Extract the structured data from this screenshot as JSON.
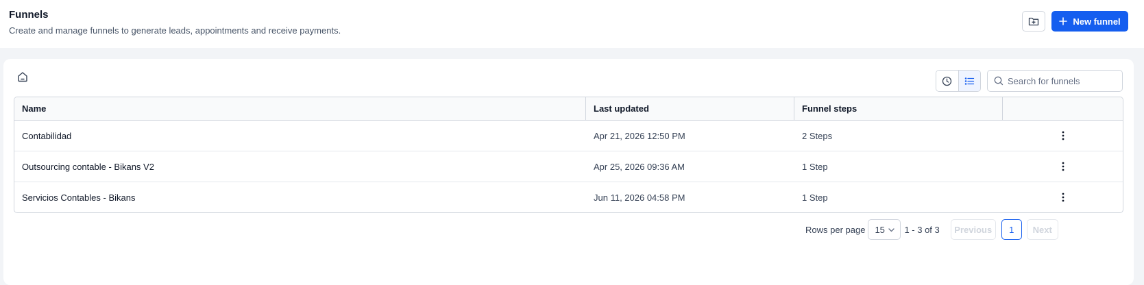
{
  "header": {
    "title": "Funnels",
    "subtitle": "Create and manage funnels to generate leads, appointments and receive payments.",
    "new_funnel_label": "New funnel"
  },
  "toolbar": {
    "search_placeholder": "Search for funnels"
  },
  "table": {
    "columns": [
      "Name",
      "Last updated",
      "Funnel steps",
      ""
    ],
    "rows": [
      {
        "name": "Contabilidad",
        "updated": "Apr 21, 2026 12:50 PM",
        "steps": "2 Steps"
      },
      {
        "name": "Outsourcing contable - Bikans V2",
        "updated": "Apr 25, 2026 09:36 AM",
        "steps": "1 Step"
      },
      {
        "name": "Servicios Contables - Bikans",
        "updated": "Jun 11, 2026 04:58 PM",
        "steps": "1 Step"
      }
    ]
  },
  "pagination": {
    "rows_per_page_label": "Rows per page",
    "rows_per_page": "15",
    "range": "1 - 3 of 3",
    "previous": "Previous",
    "current_page": "1",
    "next": "Next"
  },
  "colors": {
    "accent": "#155eef",
    "background": "#f2f4f7",
    "border": "#d0d5dd"
  },
  "icons": {
    "folder": "folder-plus-icon",
    "plus": "plus-icon",
    "home": "home-icon",
    "clock": "clock-icon",
    "list": "list-icon",
    "search": "search-icon",
    "more": "more-vertical-icon",
    "chevron": "chevron-down-icon"
  }
}
